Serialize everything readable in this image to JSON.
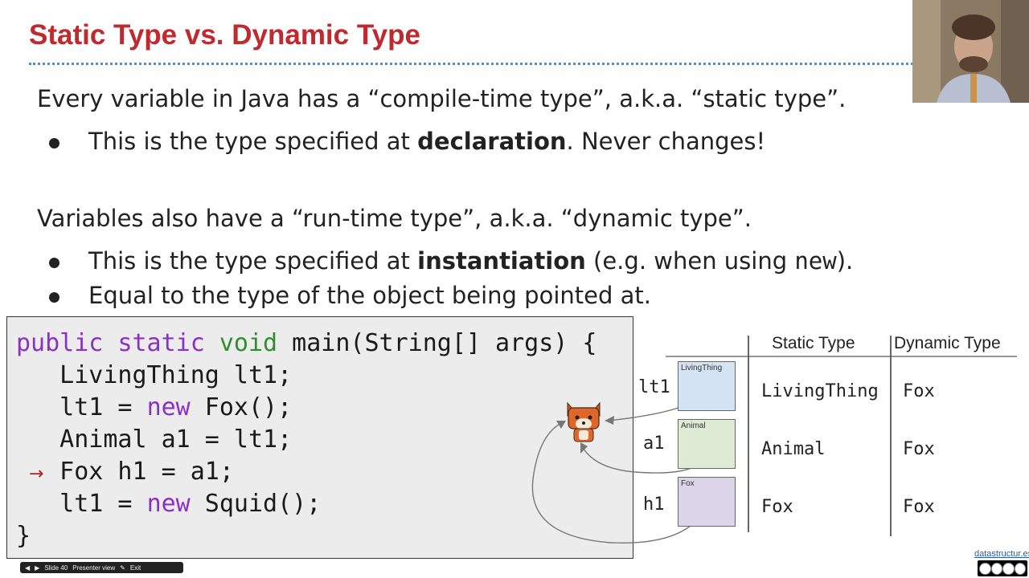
{
  "slide": {
    "title": "Static Type vs. Dynamic Type",
    "para1": "Every variable in Java has a “compile-time type”, a.k.a. “static type”.",
    "bullet1_pre": "This is the type specified at ",
    "bullet1_bold": "declaration",
    "bullet1_post": ". Never changes!",
    "para2": "Variables also have a “run-time type”, a.k.a. “dynamic type”.",
    "bullet2_pre": "This is the type specified at ",
    "bullet2_bold": "instantiation",
    "bullet2_mid": " (e.g. when using ",
    "bullet2_code": "new",
    "bullet2_post": ").",
    "bullet3": "Equal to the type of the object being pointed at."
  },
  "code": {
    "l1_kw1": "public",
    "l1_kw2": "static",
    "l1_kw3": "void",
    "l1_rest": " main(String[] args) {",
    "l2": "   LivingThing lt1;",
    "l3_a": "   lt1 = ",
    "l3_kw": "new",
    "l3_b": " Fox();",
    "l4": "   Animal a1 = lt1;",
    "l5": "   Fox h1 = a1;",
    "l6_a": "   lt1 = ",
    "l6_kw": "new",
    "l6_b": " Squid();",
    "l7": "}",
    "arrow": "→"
  },
  "table": {
    "header_static": "Static Type",
    "header_dynamic": "Dynamic Type",
    "rows": [
      {
        "var": "lt1",
        "box_label": "LivingThing",
        "static": "LivingThing",
        "dynamic": "Fox",
        "box_color": "#d5e4f3"
      },
      {
        "var": "a1",
        "box_label": "Animal",
        "static": "Animal",
        "dynamic": "Fox",
        "box_color": "#dfecd5"
      },
      {
        "var": "h1",
        "box_label": "Fox",
        "static": "Fox",
        "dynamic": "Fox",
        "box_color": "#dcd5ea"
      }
    ]
  },
  "toolbar": {
    "slide_label": "Slide 40",
    "presenter_label": "Presenter view",
    "exit_label": "Exit"
  },
  "footer": {
    "site": "datastructur.es"
  },
  "colors": {
    "title": "#c0292e",
    "keyword_purple": "#8b2fc9",
    "keyword_green": "#2f8f2f",
    "rule": "#4f8fd0"
  }
}
